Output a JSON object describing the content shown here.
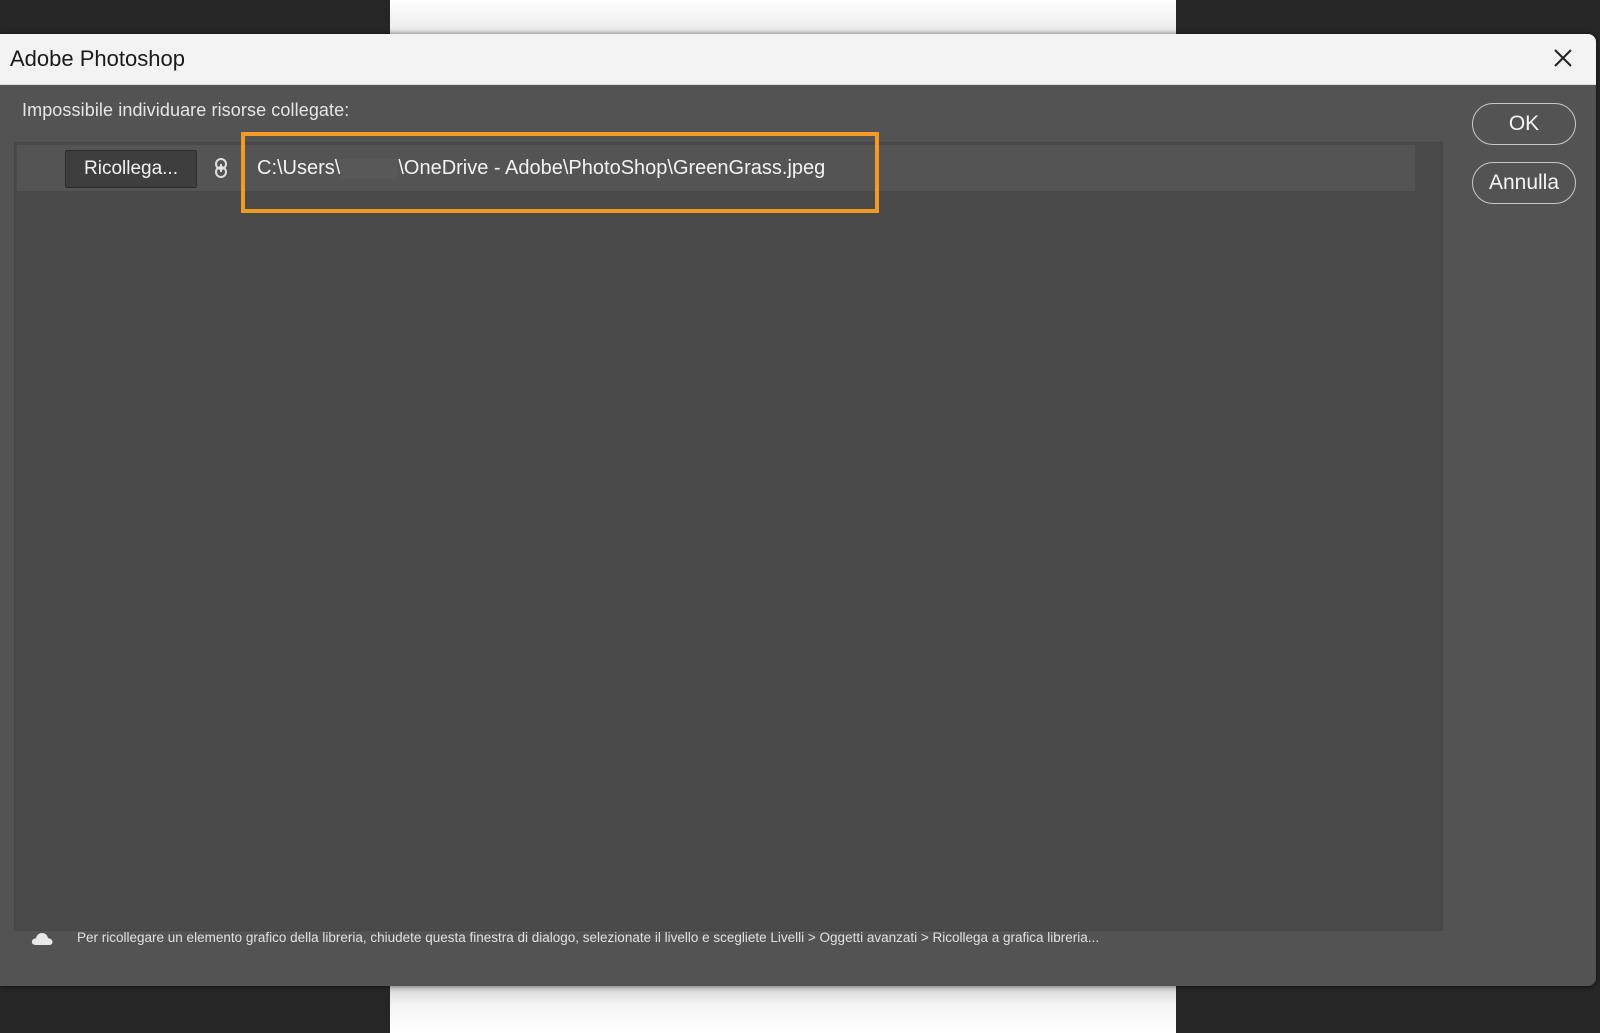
{
  "window": {
    "title": "Adobe Photoshop"
  },
  "dialog": {
    "heading": "Impossibile individuare risorse collegate:",
    "missing_items": [
      {
        "relink_label": "Ricollega...",
        "path_prefix": "C:\\Users\\",
        "path_suffix": "\\OneDrive - Adobe\\PhotoShop\\GreenGrass.jpeg"
      }
    ],
    "buttons": {
      "ok": "OK",
      "cancel": "Annulla"
    },
    "footer_note": "Per ricollegare un elemento grafico della libreria, chiudete questa finestra di dialogo, selezionate il livello e scegliete Livelli > Oggetti avanzati > Ricollega a grafica libreria..."
  },
  "icons": {
    "close": "close-icon",
    "link": "link-icon",
    "cloud": "cloud-icon"
  },
  "colors": {
    "dialog_bg": "#535353",
    "panel_bg": "#4a4a4a",
    "titlebar_bg": "#f3f3f3",
    "highlight": "#f39a25",
    "text": "#f2f2f2"
  }
}
